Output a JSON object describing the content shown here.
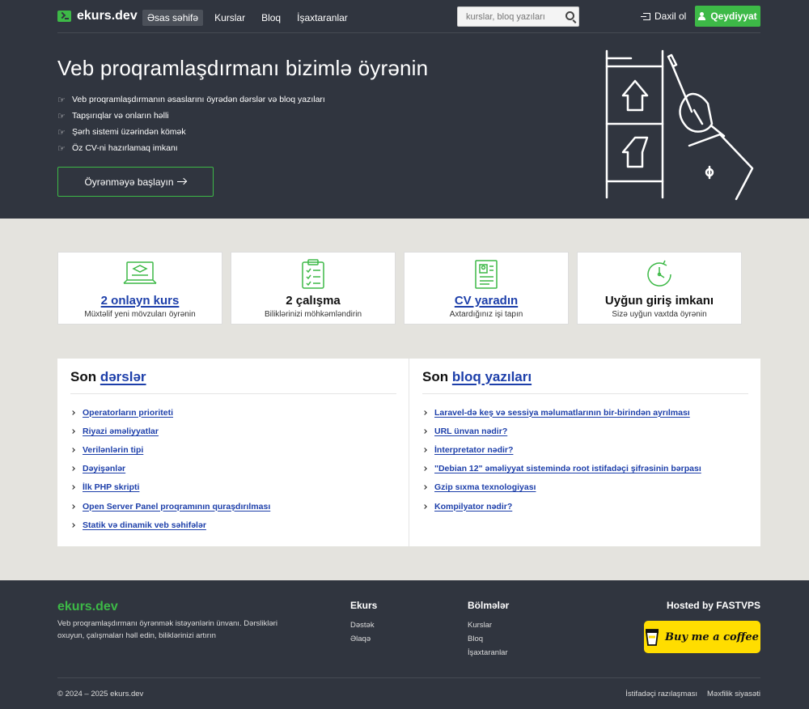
{
  "header": {
    "logo": "ekurs.dev",
    "nav": [
      "Əsas səhifə",
      "Kurslar",
      "Bloq",
      "İşaxtaranlar"
    ],
    "search_placeholder": "kurslar, bloq yazıları",
    "login": "Daxil ol",
    "register": "Qeydiyyat"
  },
  "hero": {
    "title": "Veb proqramlaşdırmanı bizimlə öyrənin",
    "points": [
      "Veb proqramlaşdırmanın əsaslarını öyrədən dərslər və bloq yazıları",
      "Tapşırıqlar və onların həlli",
      "Şərh sistemi üzərindən kömək",
      "Öz CV-ni hazırlamaq imkanı"
    ],
    "cta": "Öyrənməyə başlayın"
  },
  "features": [
    {
      "title": "2 onlayn kurs",
      "subtitle": "Müxtəlif yeni mövzuları öyrənin",
      "link": true,
      "icon": "laptop-icon"
    },
    {
      "title": "2 çalışma",
      "subtitle": "Biliklərinizi möhkəmləndirin",
      "link": false,
      "icon": "clipboard-icon"
    },
    {
      "title": "CV yaradın",
      "subtitle": "Axtardığınız işi tapın",
      "link": true,
      "icon": "resume-icon"
    },
    {
      "title": "Uyğun giriş imkanı",
      "subtitle": "Sizə uyğun vaxtda öyrənin",
      "link": false,
      "icon": "clock-icon"
    }
  ],
  "lessons": {
    "title_prefix": "Son",
    "title_link": "dərslər",
    "items": [
      "Operatorların prioriteti",
      "Riyazi əməliyyatlar",
      "Verilənlərin tipi",
      "Dəyişənlər",
      "İlk PHP skripti",
      "Open Server Panel proqramının quraşdırılması",
      "Statik və dinamik veb səhifələr"
    ]
  },
  "blog": {
    "title_prefix": "Son",
    "title_link": "bloq yazıları",
    "items": [
      "Laravel-də keş və sessiya məlumatlarının bir-birindən ayrılması",
      "URL ünvan nədir?",
      "İnterpretator nədir?",
      "\"Debian 12\" əməliyyat sistemində root istifadəçi şifrəsinin bərpası",
      "Gzip sıxma texnologiyası",
      "Kompilyator nədir?"
    ]
  },
  "footer": {
    "logo": "ekurs.dev",
    "description": "Veb proqramlaşdırmanı öyrənmək istəyənlərin ünvanı. Dərslikləri oxuyun, çalışmaları həll edin, biliklərinizi artırın",
    "col1_title": "Ekurs",
    "col1_links": [
      "Dəstək",
      "Əlaqə"
    ],
    "col2_title": "Bölmələr",
    "col2_links": [
      "Kurslar",
      "Bloq",
      "İşaxtaranlar"
    ],
    "hosted": "Hosted by FASTVPS",
    "coffee": "Buy me a coffee",
    "copyright": "© 2024 – 2025 ekurs.dev",
    "legal": [
      "İstifadəçi razılaşması",
      "Məxfilik siyasəti"
    ]
  },
  "colors": {
    "dark": "#30353f",
    "accent": "#3db947",
    "link": "#1d3faa",
    "background": "#e4e3de"
  }
}
